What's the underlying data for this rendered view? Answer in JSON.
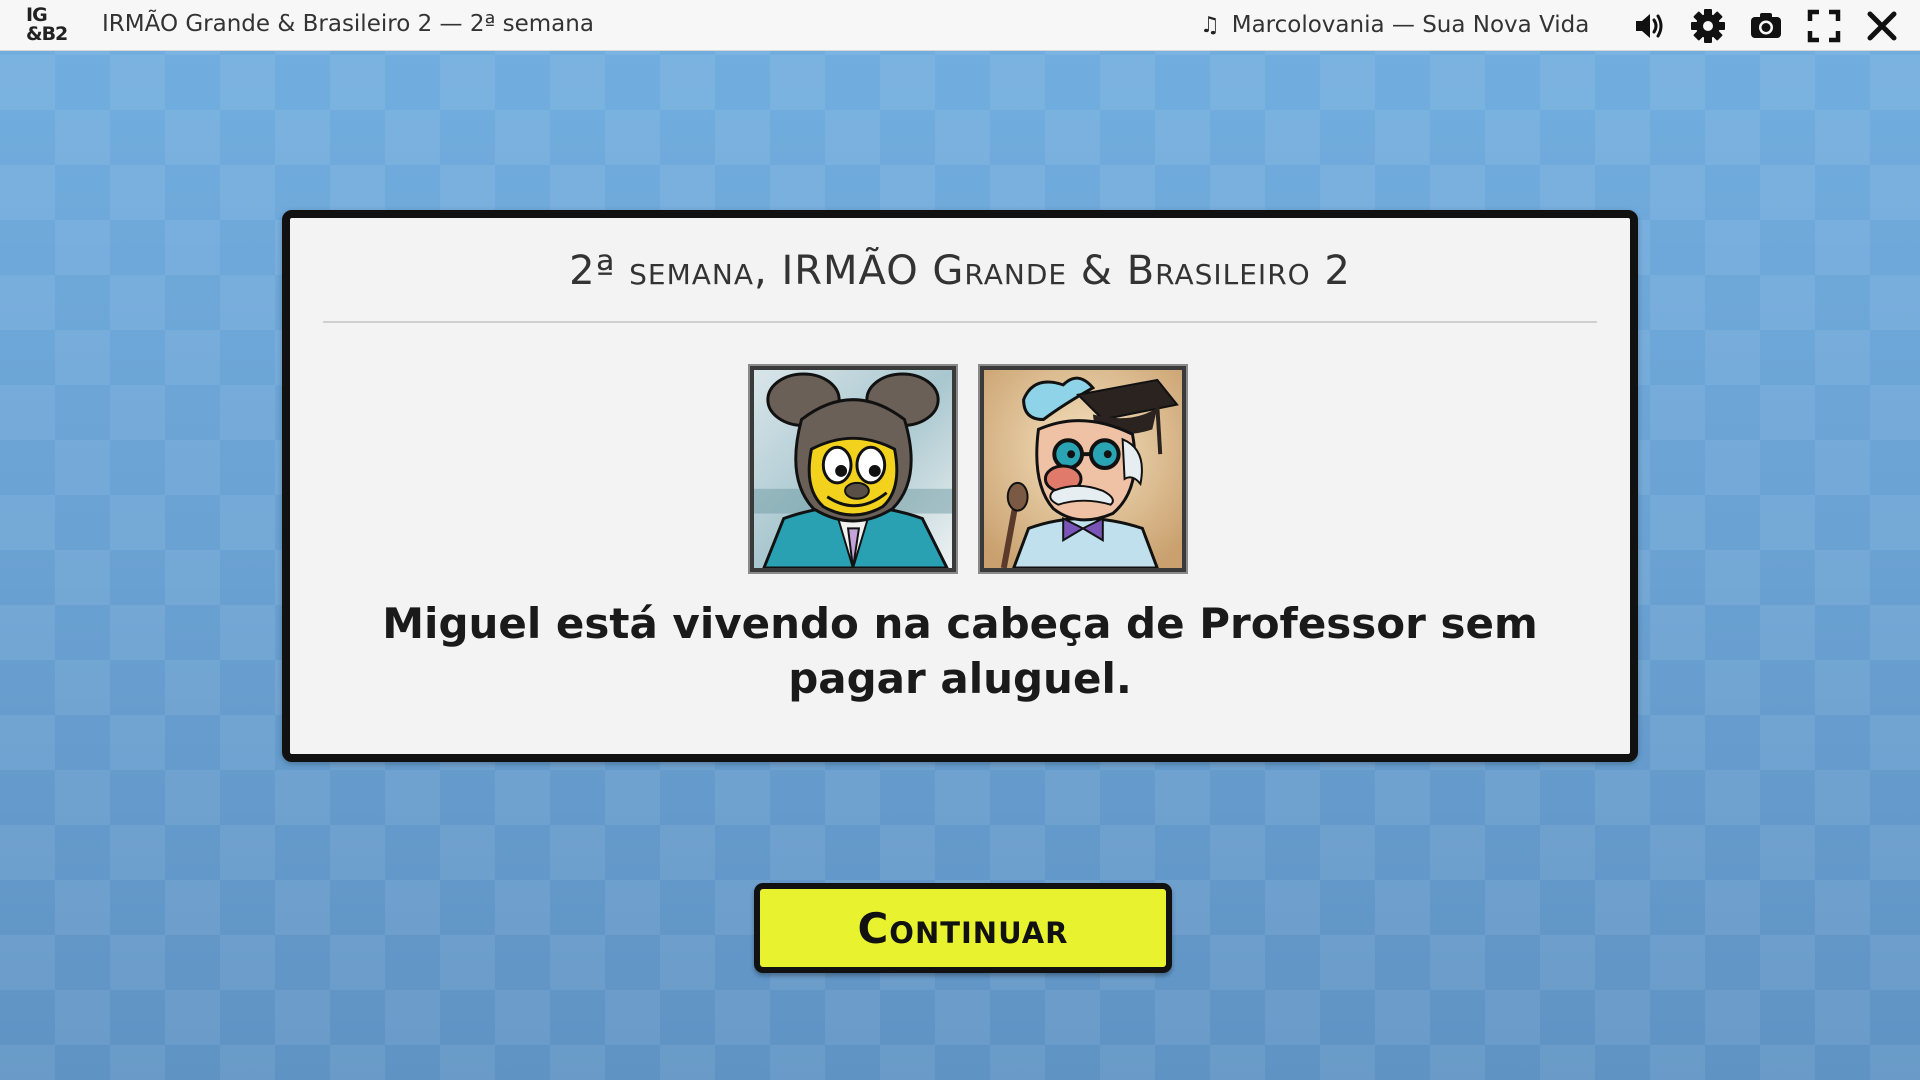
{
  "app": {
    "logo_line1": "IG",
    "logo_line2": "&B2",
    "title": "IRMÃO Grande & Brasileiro 2 — 2ª semana"
  },
  "music": {
    "icon": "music-note-icon",
    "track": "Marcolovania — Sua Nova Vida"
  },
  "toolbar": {
    "icons": [
      "volume-icon",
      "gear-icon",
      "camera-icon",
      "fullscreen-icon",
      "close-icon"
    ]
  },
  "dialog": {
    "title": "2ª semana, IRMÃO Grande & Brasileiro 2",
    "portraits": [
      {
        "character": "Miguel"
      },
      {
        "character": "Professor"
      }
    ],
    "message": "Miguel está vivendo na cabeça de Professor sem pagar aluguel."
  },
  "continue_button": {
    "label": "Continuar",
    "color": "#e8f22e"
  },
  "colors": {
    "background": "#6ea6d6",
    "topbar": "#f7f7f7",
    "dialog": "#f3f3f3"
  }
}
